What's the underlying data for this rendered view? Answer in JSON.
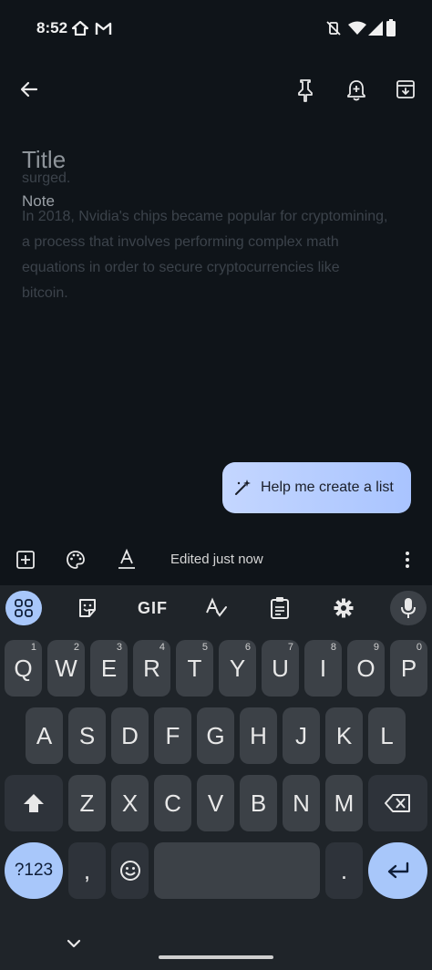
{
  "status_bar": {
    "time": "8:52",
    "icons": [
      "home-icon",
      "gmail-icon",
      "vibrate-off-icon",
      "wifi-icon",
      "signal-icon",
      "battery-icon"
    ]
  },
  "app_bar": {
    "icons": [
      "back-arrow-icon",
      "pin-icon",
      "reminder-icon",
      "archive-icon"
    ]
  },
  "note": {
    "ghost_lines": [
      "surged.",
      "In 2018, Nvidia's chips became popular for cryptomining,",
      "a process that involves performing complex math",
      "equations in order to secure cryptocurrencies like",
      "bitcoin."
    ],
    "title_placeholder": "Title",
    "note_placeholder": "Note"
  },
  "help_chip": {
    "label": "Help me create a list"
  },
  "bottom_toolbar": {
    "status": "Edited just now",
    "icons": [
      "add-box-icon",
      "palette-icon",
      "text-format-icon",
      "more-vert-icon"
    ]
  },
  "keyboard": {
    "toolbar_icons": [
      "apps-grid-icon",
      "sticker-icon",
      "gif-icon",
      "handwriting-icon",
      "clipboard-icon",
      "settings-icon",
      "mic-icon"
    ],
    "gif_label": "GIF",
    "row1": [
      {
        "key": "Q",
        "hint": "1"
      },
      {
        "key": "W",
        "hint": "2"
      },
      {
        "key": "E",
        "hint": "3"
      },
      {
        "key": "R",
        "hint": "4"
      },
      {
        "key": "T",
        "hint": "5"
      },
      {
        "key": "Y",
        "hint": "6"
      },
      {
        "key": "U",
        "hint": "7"
      },
      {
        "key": "I",
        "hint": "8"
      },
      {
        "key": "O",
        "hint": "9"
      },
      {
        "key": "P",
        "hint": "0"
      }
    ],
    "row2": [
      "A",
      "S",
      "D",
      "F",
      "G",
      "H",
      "J",
      "K",
      "L"
    ],
    "row3": [
      "Z",
      "X",
      "C",
      "V",
      "B",
      "N",
      "M"
    ],
    "symbols_label": "?123",
    "comma_label": ",",
    "period_label": ".",
    "accent_color": "#a8c7fa"
  }
}
